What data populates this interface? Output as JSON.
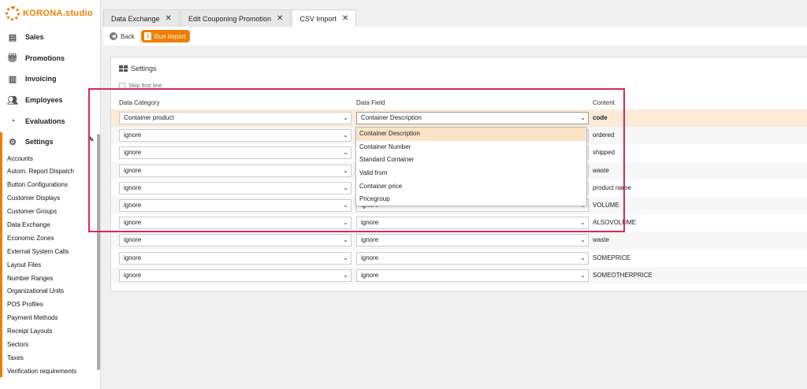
{
  "app": {
    "brand": "KORONA.studio"
  },
  "nav": {
    "items": [
      {
        "label": "Sales",
        "icon": "receipt-icon"
      },
      {
        "label": "Promotions",
        "icon": "gift-icon"
      },
      {
        "label": "Invoicing",
        "icon": "invoice-icon"
      },
      {
        "label": "Employees",
        "icon": "users-icon"
      },
      {
        "label": "Evaluations",
        "icon": "pie-chart-icon"
      },
      {
        "label": "Settings",
        "icon": "gear-icon"
      }
    ],
    "sub_items": [
      "Accounts",
      "Autom. Report Dispatch",
      "Button Configurations",
      "Customer Displays",
      "Customer Groups",
      "Data Exchange",
      "Economic Zones",
      "External System Calls",
      "Layout Files",
      "Number Ranges",
      "Organizational Units",
      "POS Profiles",
      "Payment Methods",
      "Receipt Layouts",
      "Sectors",
      "Taxes",
      "Verification requirements"
    ]
  },
  "tabs": [
    {
      "label": "Data Exchange"
    },
    {
      "label": "Edit Couponing Promotion"
    },
    {
      "label": "CSV Import"
    }
  ],
  "toolbar": {
    "back_label": "Back",
    "run_label": "Run Import"
  },
  "panel": {
    "title": "Settings",
    "skip_label": "Skip first line",
    "headers": {
      "category": "Data Category",
      "field": "Data Field",
      "content": "Content"
    }
  },
  "rows": [
    {
      "category": "Container product",
      "field": "Container Description",
      "content": "code"
    },
    {
      "category": "ignore",
      "field": "",
      "content": "ordered"
    },
    {
      "category": "ignore",
      "field": "",
      "content": "shipped"
    },
    {
      "category": "ignore",
      "field": "",
      "content": "waste"
    },
    {
      "category": "ignore",
      "field": "",
      "content": "product name"
    },
    {
      "category": "ignore",
      "field": "ignore",
      "content": "VOLUME"
    },
    {
      "category": "ignore",
      "field": "ignore",
      "content": "ALSOVOLUME"
    },
    {
      "category": "ignore",
      "field": "ignore",
      "content": "waste"
    },
    {
      "category": "ignore",
      "field": "ignore",
      "content": "SOMEPRICE"
    },
    {
      "category": "ignore",
      "field": "ignore",
      "content": "SOMEOTHERPRICE"
    }
  ],
  "dropdown": {
    "options": [
      "Container Description",
      "Container Number",
      "Standard Container",
      "Valid from",
      "Container price",
      "Pricegroup"
    ],
    "selected": "Container Description"
  },
  "colors": {
    "accent": "#f07d00",
    "annotation": "#d62a55"
  }
}
